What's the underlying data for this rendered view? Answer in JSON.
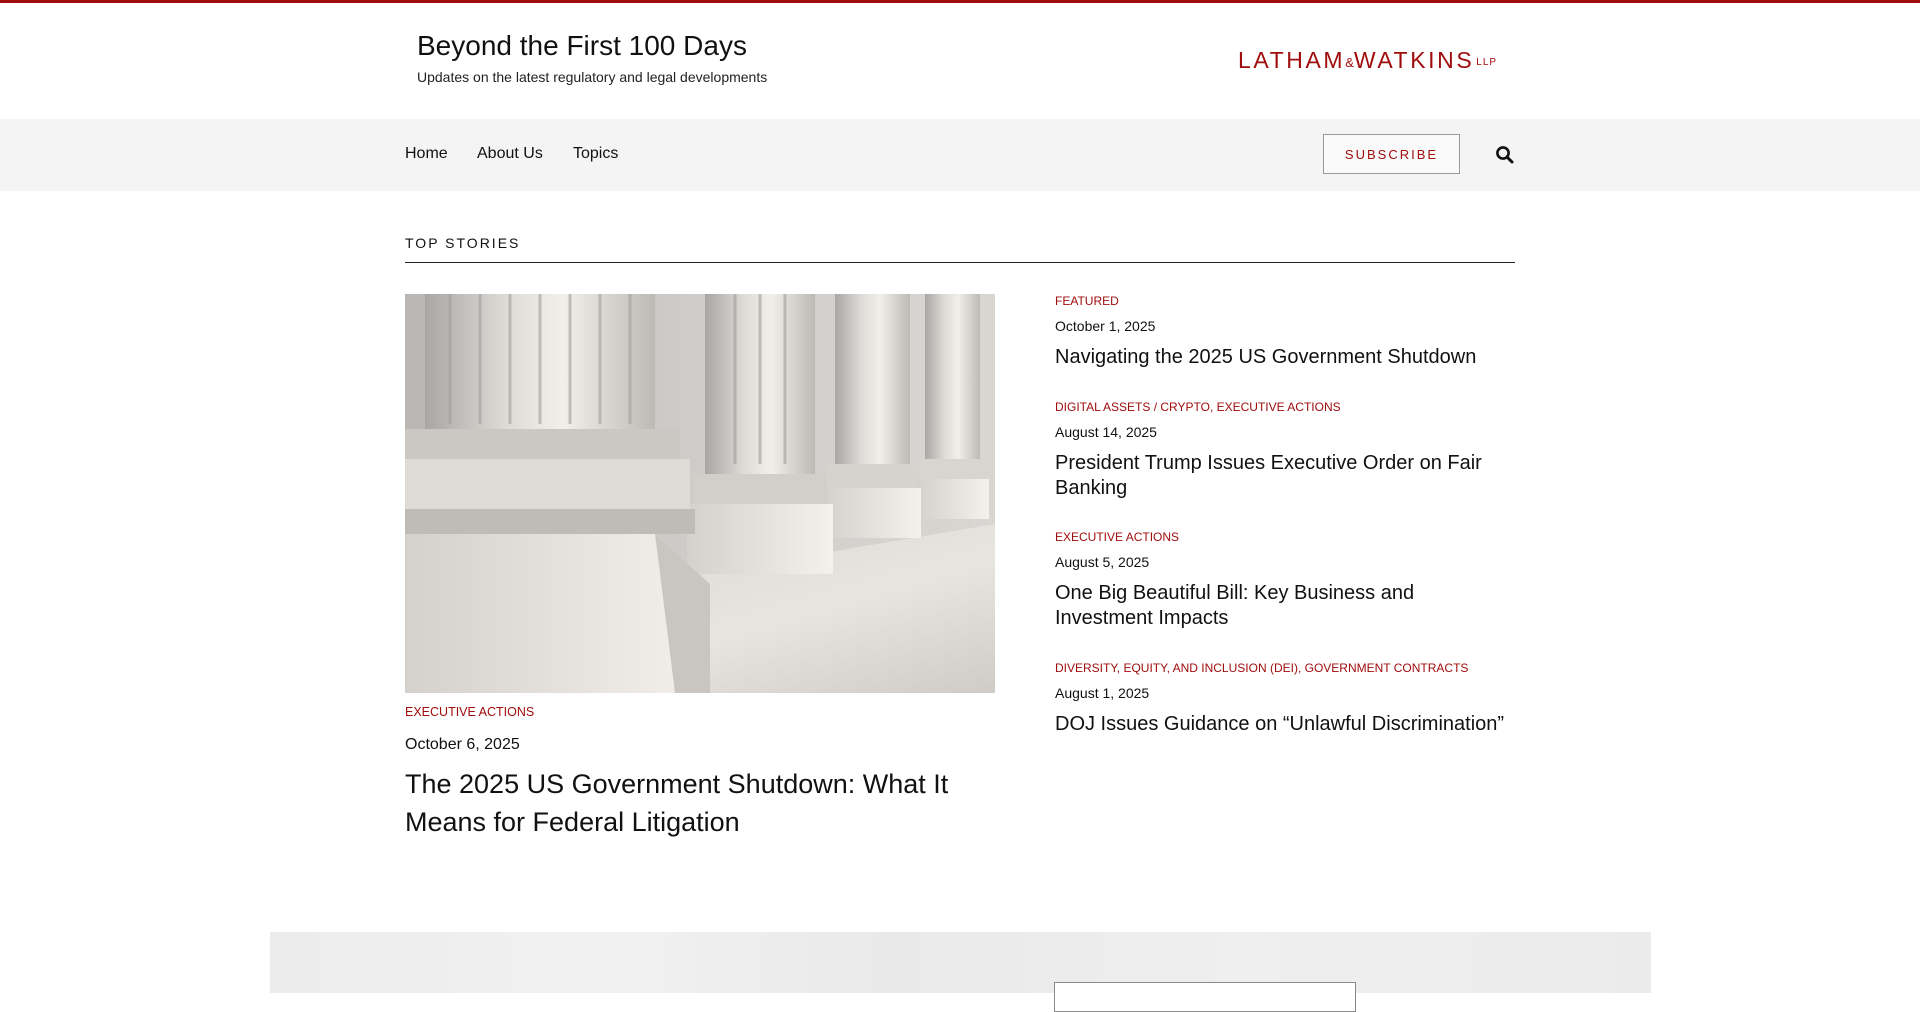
{
  "header": {
    "site_title": "Beyond the First 100 Days",
    "tagline": "Updates on the latest regulatory and legal developments",
    "logo": {
      "part1": "LATHAM",
      "amp": "&",
      "part2": "WATKINS",
      "suffix": "LLP"
    }
  },
  "nav": {
    "items": [
      {
        "label": "Home"
      },
      {
        "label": "About Us"
      },
      {
        "label": "Topics"
      }
    ],
    "subscribe_label": "SUBSCRIBE",
    "search_icon": "search-icon"
  },
  "top_stories": {
    "label": "TOP STORIES",
    "hero": {
      "image": "courthouse-columns-image",
      "category": "EXECUTIVE ACTIONS",
      "date": "October 6, 2025",
      "title": "The 2025 US Government Shutdown: What It Means for Federal Litigation"
    },
    "stories": [
      {
        "categories": [
          "Featured"
        ],
        "date": "October 1, 2025",
        "title": "Navigating the 2025 US Government Shutdown"
      },
      {
        "categories": [
          "Digital Assets / Crypto",
          "Executive Actions"
        ],
        "date": "August 14, 2025",
        "title": "President Trump Issues Executive Order on Fair Banking"
      },
      {
        "categories": [
          "Executive Actions"
        ],
        "date": "August 5, 2025",
        "title": "One Big Beautiful Bill: Key Business and Investment Impacts"
      },
      {
        "categories": [
          "Diversity, Equity, and Inclusion (DEI)",
          "Government Contracts"
        ],
        "date": "August 1, 2025",
        "title": "DOJ Issues Guidance on “Unlawful Discrimination”"
      }
    ]
  },
  "colors": {
    "accent": "#a00d0d",
    "nav_background": "#f4f4f4",
    "text": "#111111"
  }
}
